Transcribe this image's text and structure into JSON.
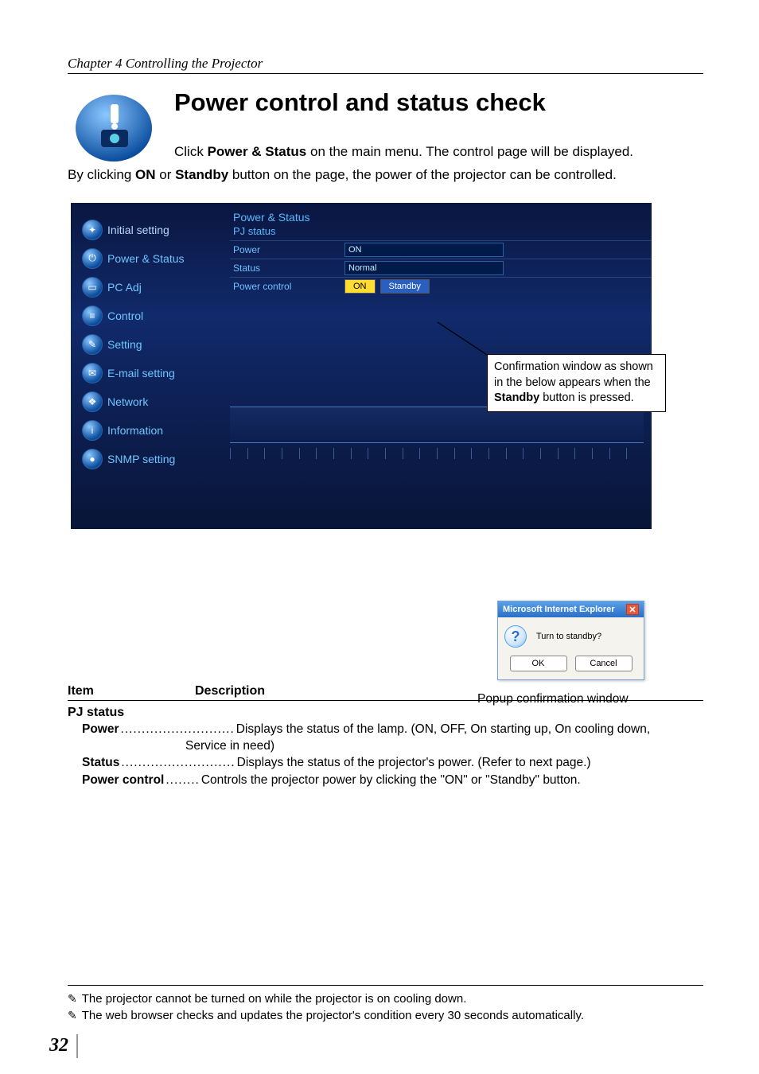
{
  "chapter": "Chapter 4 Controlling the Projector",
  "heading": "Power control and status check",
  "intro1a": "Click ",
  "intro1b": "Power & Status",
  "intro1c": " on the main menu. The control page will be displayed.",
  "intro2a": "By clicking ",
  "intro2b": "ON",
  "intro2c": " or ",
  "intro2d": "Standby",
  "intro2e": " button on the page, the power of the projector can be controlled.",
  "sidebar": {
    "items": [
      "Initial setting",
      "Power & Status",
      "PC Adj",
      "Control",
      "Setting",
      "E-mail setting",
      "Network",
      "Information",
      "SNMP setting"
    ]
  },
  "panel": {
    "title": "Power & Status",
    "subtitle": "PJ status",
    "rows": {
      "power_label": "Power",
      "power_value": "ON",
      "status_label": "Status",
      "status_value": "Normal",
      "control_label": "Power control",
      "btn_on": "ON",
      "btn_standby": "Standby"
    }
  },
  "callout": {
    "line1": "Confirmation window  as shown",
    "line2": "in the below appears  when the",
    "line3a": "Standby",
    "line3b": " button is pressed."
  },
  "popup": {
    "title": "Microsoft Internet Explorer",
    "message": "Turn to standby?",
    "ok": "OK",
    "cancel": "Cancel"
  },
  "popup_caption": "Popup confirmation window",
  "table": {
    "h1": "Item",
    "h2": "Description",
    "section": "PJ status",
    "r1_term": "Power",
    "r1_defn": "Displays the status of the lamp. (ON, OFF, On starting up, On cooling down,",
    "r1_cont": "Service in need)",
    "r2_term": "Status",
    "r2_defn": "Displays the status of the projector's power. (Refer to next page.)",
    "r3_term": "Power control",
    "r3_defn": "Controls the projector power by clicking the \"ON\" or \"Standby\" button."
  },
  "footnotes": {
    "n1": "The projector cannot be turned on while the projector is on cooling down.",
    "n2": "The web browser checks and updates the projector's condition every 30 seconds automatically."
  },
  "page_number": "32"
}
